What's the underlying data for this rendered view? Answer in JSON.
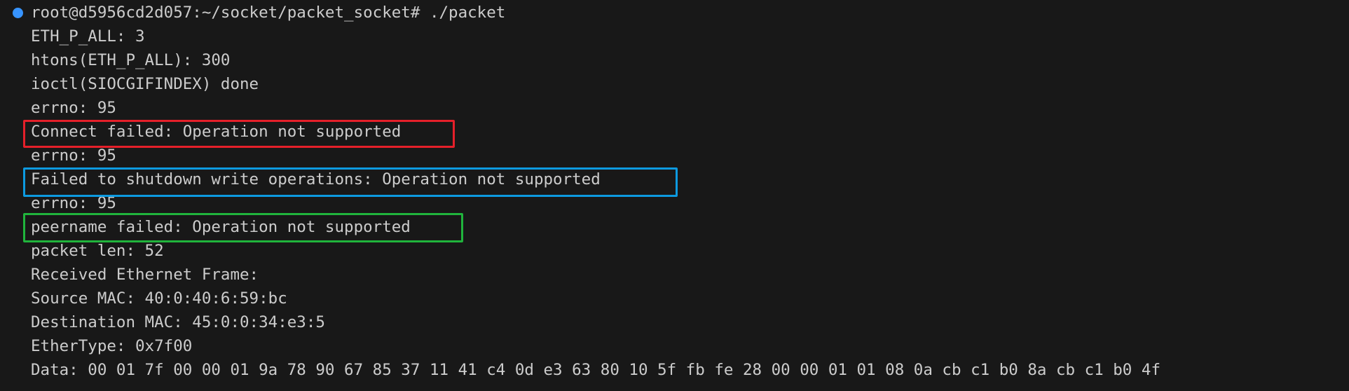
{
  "terminal": {
    "prompt_line": "root@d5956cd2d057:~/socket/packet_socket# ./packet",
    "lines": [
      "ETH_P_ALL: 3",
      "htons(ETH_P_ALL): 300",
      "ioctl(SIOCGIFINDEX) done",
      "errno: 95",
      "Connect failed: Operation not supported",
      "errno: 95",
      "Failed to shutdown write operations: Operation not supported",
      "errno: 95",
      "peername failed: Operation not supported",
      "packet len: 52",
      "Received Ethernet Frame:",
      "Source MAC: 40:0:40:6:59:bc",
      "Destination MAC: 45:0:0:34:e3:5",
      "EtherType: 0x7f00",
      "Data: 00 01 7f 00 00 01 9a 78 90 67 85 37 11 41 c4 0d e3 63 80 10 5f fb fe 28 00 00 01 01 08 0a cb c1 b0 8a cb c1 b0 4f"
    ],
    "prompt_indicator_icon": "circle-dot-icon"
  },
  "colors": {
    "background": "#181818",
    "text": "#cccccc",
    "prompt_dot": "#3794ff",
    "highlight_red": "#e5202a",
    "highlight_blue": "#0d9ae0",
    "highlight_green": "#20b43c"
  }
}
